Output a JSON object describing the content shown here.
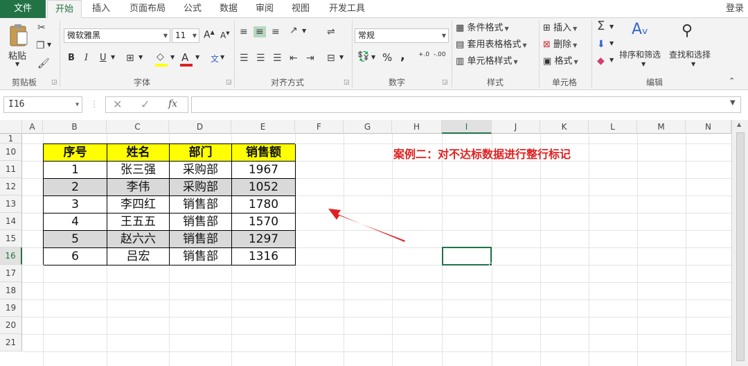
{
  "menu": {
    "tabs": [
      "文件",
      "开始",
      "插入",
      "页面布局",
      "公式",
      "数据",
      "审阅",
      "视图",
      "开发工具"
    ],
    "active_index": 1,
    "login": "登录"
  },
  "ribbon": {
    "clipboard": {
      "paste": "粘贴",
      "label": "剪贴板"
    },
    "font": {
      "name": "微软雅黑",
      "size": "11",
      "grow": "A",
      "shrink": "A",
      "bold": "B",
      "italic": "I",
      "underline": "U",
      "font_color_letter": "A",
      "phonetic": "文",
      "label": "字体"
    },
    "alignment": {
      "label": "对齐方式"
    },
    "number": {
      "format": "常规",
      "percent": "%",
      "comma": ",",
      "inc_decimal": "+.0",
      "dec_decimal": "-.00",
      "label": "数字"
    },
    "styles": {
      "conditional": "条件格式",
      "table": "套用表格格式",
      "cell_styles": "单元格样式",
      "label": "样式"
    },
    "cells": {
      "insert": "插入",
      "delete": "删除",
      "format": "格式",
      "label": "单元格"
    },
    "editing": {
      "sort_filter": "排序和筛选",
      "find_select": "查找和选择",
      "label": "编辑"
    }
  },
  "formula_bar": {
    "name_box": "I16",
    "fx": "fx",
    "content": ""
  },
  "grid": {
    "columns": [
      "A",
      "B",
      "C",
      "D",
      "E",
      "F",
      "G",
      "H",
      "I",
      "J",
      "K",
      "L",
      "M",
      "N"
    ],
    "selected_column": "I",
    "rows": [
      "1",
      "10",
      "11",
      "12",
      "13",
      "14",
      "15",
      "16",
      "17",
      "18",
      "19",
      "20",
      "21"
    ],
    "selected_row": "16",
    "table": {
      "headers": [
        "序号",
        "姓名",
        "部门",
        "销售额"
      ],
      "rows": [
        [
          "1",
          "张三强",
          "采购部",
          "1967"
        ],
        [
          "2",
          "李伟",
          "采购部",
          "1052"
        ],
        [
          "3",
          "李四红",
          "销售部",
          "1780"
        ],
        [
          "4",
          "王五五",
          "销售部",
          "1570"
        ],
        [
          "5",
          "赵六六",
          "销售部",
          "1297"
        ],
        [
          "6",
          "吕宏",
          "销售部",
          "1316"
        ]
      ],
      "shaded_rows": [
        1,
        4
      ]
    },
    "note": "案例二：对不达标数据进行整行标记"
  },
  "colors": {
    "accent": "#217346",
    "header_fill": "#ffff00",
    "shade_fill": "#d9d9d9",
    "note_color": "#e02020"
  }
}
